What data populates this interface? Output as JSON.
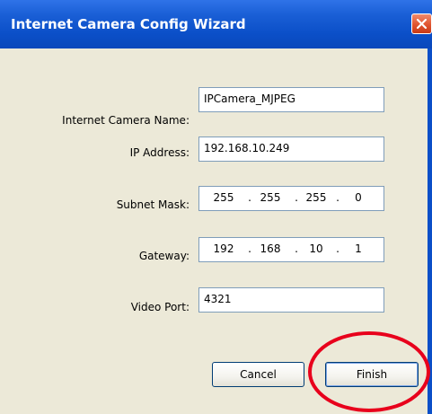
{
  "window": {
    "title": "Internet Camera Config Wizard"
  },
  "form": {
    "camera_name": {
      "label": "Internet Camera Name:",
      "value": "IPCamera_MJPEG"
    },
    "ip_address": {
      "label": "IP Address:",
      "value": "192.168.10.249"
    },
    "subnet_mask": {
      "label": "Subnet Mask:",
      "octets": [
        "255",
        "255",
        "255",
        "0"
      ]
    },
    "gateway": {
      "label": "Gateway:",
      "octets": [
        "192",
        "168",
        "10",
        "1"
      ]
    },
    "video_port": {
      "label": "Video Port:",
      "value": "4321"
    }
  },
  "buttons": {
    "cancel": "Cancel",
    "finish": "Finish"
  },
  "ip_separator": ".",
  "colors": {
    "titlebar": "#0b4fc8",
    "dialog_bg": "#ece9d8",
    "close_button": "#e0542f",
    "highlight_circle": "#e8001c"
  },
  "icons": {
    "close": "close-icon"
  }
}
